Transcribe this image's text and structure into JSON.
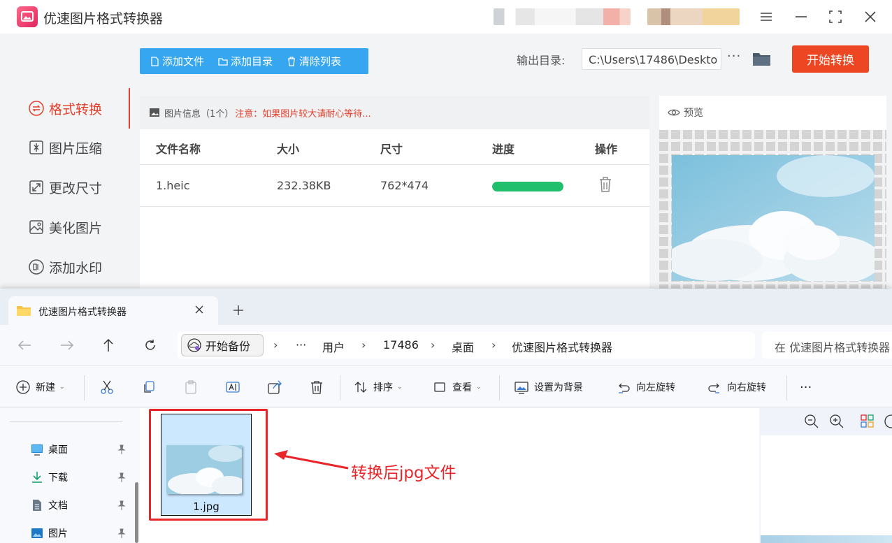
{
  "app": {
    "title": "优速图片格式转换器",
    "toolbar": {
      "add_file": "添加文件",
      "add_dir": "添加目录",
      "clear_list": "清除列表"
    },
    "output": {
      "label": "输出目录:",
      "path": "C:\\Users\\17486\\Deskto",
      "more": "···"
    },
    "start_button": "开始转换",
    "sidebar": [
      {
        "label": "格式转换",
        "icon": "convert-icon",
        "active": true
      },
      {
        "label": "图片压缩",
        "icon": "compress-icon"
      },
      {
        "label": "更改尺寸",
        "icon": "resize-icon"
      },
      {
        "label": "美化图片",
        "icon": "beautify-icon"
      },
      {
        "label": "添加水印",
        "icon": "watermark-icon"
      }
    ],
    "info_bar": {
      "title": "图片信息（1个）",
      "note": "注意：如果图片较大请耐心等待..."
    },
    "table": {
      "headers": [
        "文件名称",
        "大小",
        "尺寸",
        "进度",
        "操作"
      ],
      "rows": [
        {
          "name": "1.heic",
          "size": "232.38KB",
          "dimensions": "762*474",
          "progress": 1.0
        }
      ]
    },
    "preview_label": "预览",
    "accent": "#e2402b",
    "toolbar_color": "#35a6ef",
    "progress_color": "#1fbf6d"
  },
  "explorer": {
    "tab_title": "优速图片格式转换器",
    "backup_button": "开始备份",
    "breadcrumb": [
      "···",
      "用户",
      "17486",
      "桌面",
      "优速图片格式转换器"
    ],
    "search_placeholder": "在 优速图片格式转换器",
    "commands": {
      "new": "新建",
      "sort": "排序",
      "view": "查看",
      "set_background": "设置为背景",
      "rotate_left": "向左旋转",
      "rotate_right": "向右旋转",
      "more": "···"
    },
    "tree": [
      {
        "label": "桌面",
        "icon": "desktop-icon"
      },
      {
        "label": "下载",
        "icon": "download-icon"
      },
      {
        "label": "文档",
        "icon": "document-icon"
      },
      {
        "label": "图片",
        "icon": "pictures-icon"
      }
    ],
    "files": [
      {
        "name": "1.jpg",
        "selected": true
      }
    ]
  },
  "annotation": {
    "text": "转换后jpg文件",
    "color": "#e8262a"
  }
}
